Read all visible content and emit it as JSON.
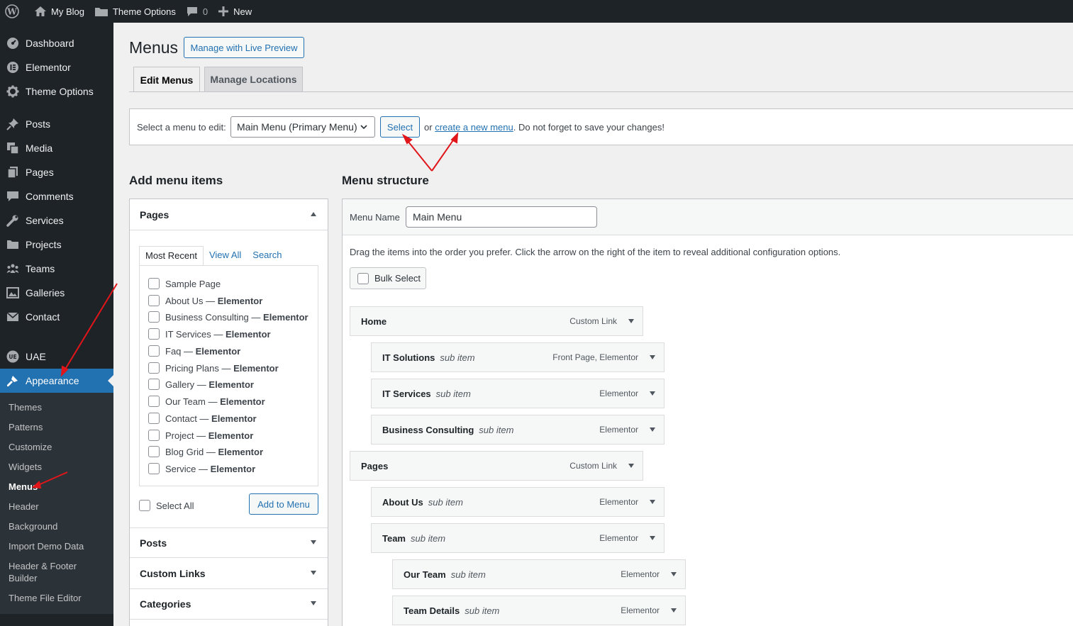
{
  "adminbar": {
    "site_name": "My Blog",
    "theme_options": "Theme Options",
    "comments_count": "0",
    "new_label": "New"
  },
  "sidebar": {
    "items": [
      {
        "label": "Dashboard",
        "icon": "dashboard-icon"
      },
      {
        "label": "Elementor",
        "icon": "elementor-icon"
      },
      {
        "label": "Theme Options",
        "icon": "gear-icon"
      },
      {
        "label": "Posts",
        "icon": "pin-icon"
      },
      {
        "label": "Media",
        "icon": "media-icon"
      },
      {
        "label": "Pages",
        "icon": "pages-icon"
      },
      {
        "label": "Comments",
        "icon": "comment-icon"
      },
      {
        "label": "Services",
        "icon": "wrench-icon"
      },
      {
        "label": "Projects",
        "icon": "folder-icon"
      },
      {
        "label": "Teams",
        "icon": "groups-icon"
      },
      {
        "label": "Galleries",
        "icon": "gallery-icon"
      },
      {
        "label": "Contact",
        "icon": "email-icon"
      },
      {
        "label": "UAE",
        "icon": "uae-icon"
      },
      {
        "label": "Appearance",
        "icon": "brush-icon"
      }
    ],
    "submenu": [
      "Themes",
      "Patterns",
      "Customize",
      "Widgets",
      "Menus",
      "Header",
      "Background",
      "Import Demo Data",
      "Header & Footer Builder",
      "Theme File Editor"
    ],
    "current_submenu": "Menus",
    "accent_color": "#2271b1"
  },
  "main": {
    "title": "Menus",
    "live_preview_button": "Manage with Live Preview",
    "tabs": [
      "Edit Menus",
      "Manage Locations"
    ],
    "select_label": "Select a menu to edit:",
    "selected_menu": "Main Menu (Primary Menu)",
    "select_button": "Select",
    "or_text": "or",
    "create_link": "create a new menu",
    "save_reminder": ". Do not forget to save your changes!"
  },
  "add_items": {
    "heading": "Add menu items",
    "pages_panel": "Pages",
    "inner_tabs": [
      "Most Recent",
      "View All",
      "Search"
    ],
    "pages": [
      {
        "title": "Sample Page",
        "suffix": ""
      },
      {
        "title": "About Us",
        "suffix": "Elementor"
      },
      {
        "title": "Business Consulting",
        "suffix": "Elementor"
      },
      {
        "title": "IT Services",
        "suffix": "Elementor"
      },
      {
        "title": "Faq",
        "suffix": "Elementor"
      },
      {
        "title": "Pricing Plans",
        "suffix": "Elementor"
      },
      {
        "title": "Gallery",
        "suffix": "Elementor"
      },
      {
        "title": "Our Team",
        "suffix": "Elementor"
      },
      {
        "title": "Contact",
        "suffix": "Elementor"
      },
      {
        "title": "Project",
        "suffix": "Elementor"
      },
      {
        "title": "Blog Grid",
        "suffix": "Elementor"
      },
      {
        "title": "Service",
        "suffix": "Elementor"
      }
    ],
    "dash": " — ",
    "select_all": "Select All",
    "add_button": "Add to Menu",
    "other_panels": [
      "Posts",
      "Custom Links",
      "Categories"
    ]
  },
  "structure": {
    "heading": "Menu structure",
    "menu_name_label": "Menu Name",
    "menu_name_value": "Main Menu",
    "instructions": "Drag the items into the order you prefer. Click the arrow on the right of the item to reveal additional configuration options.",
    "bulk_select": "Bulk Select",
    "sub_item_label": "sub item",
    "items": [
      {
        "title": "Home",
        "type": "Custom Link",
        "depth": 0
      },
      {
        "title": "IT Solutions",
        "type": "Front Page, Elementor",
        "depth": 1
      },
      {
        "title": "IT Services",
        "type": "Elementor",
        "depth": 1
      },
      {
        "title": "Business Consulting",
        "type": "Elementor",
        "depth": 1
      },
      {
        "title": "Pages",
        "type": "Custom Link",
        "depth": 0
      },
      {
        "title": "About Us",
        "type": "Elementor",
        "depth": 1
      },
      {
        "title": "Team",
        "type": "Elementor",
        "depth": 1
      },
      {
        "title": "Our Team",
        "type": "Elementor",
        "depth": 2
      },
      {
        "title": "Team Details",
        "type": "Elementor",
        "depth": 2
      }
    ]
  },
  "annotation_color": "#e0161a"
}
